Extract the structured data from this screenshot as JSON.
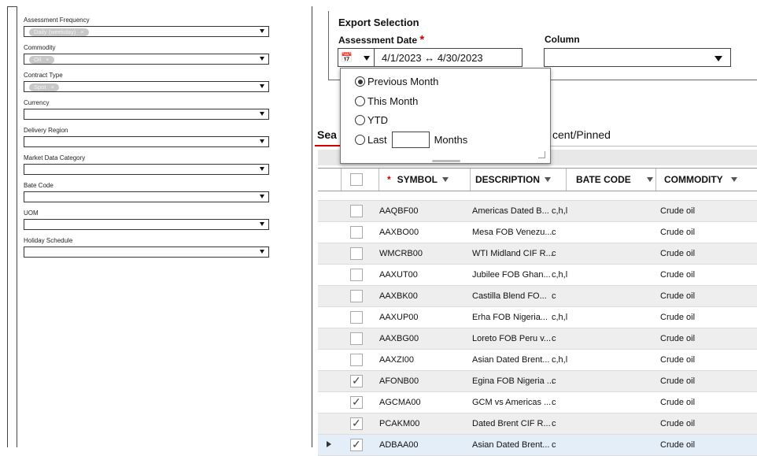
{
  "filters": [
    {
      "label": "Assessment Frequency",
      "chip": "Daily (weekday)"
    },
    {
      "label": "Commodity",
      "chip": "Oil"
    },
    {
      "label": "Contract Type",
      "chip": "Spot"
    },
    {
      "label": "Currency",
      "chip": ""
    },
    {
      "label": "Delivery Region",
      "chip": ""
    },
    {
      "label": "Market Data Category",
      "chip": ""
    },
    {
      "label": "Bate Code",
      "chip": ""
    },
    {
      "label": "UOM",
      "chip": ""
    },
    {
      "label": "Holiday Schedule",
      "chip": ""
    }
  ],
  "export": {
    "title": "Export Selection",
    "assessment_date_label": "Assessment Date",
    "required_mark": "*",
    "date_range": "4/1/2023  ↔  4/30/2023",
    "column_label": "Column"
  },
  "date_popup": {
    "options": [
      "Previous Month",
      "This Month",
      "YTD",
      "Last"
    ],
    "selected": "Previous Month",
    "months_suffix": "Months"
  },
  "tabs": {
    "search": "Sea",
    "recent": "cent/Pinned"
  },
  "grid": {
    "headers": {
      "symbol": "SYMBOL",
      "description": "DESCRIPTION",
      "bate": "BATE CODE",
      "commodity": "COMMODITY"
    },
    "required_mark": "*",
    "rows": [
      {
        "symbol": "AAQBF00",
        "description": "Americas Dated B...",
        "bate": "c,h,l",
        "commodity": "Crude oil",
        "checked": false
      },
      {
        "symbol": "AAXBO00",
        "description": "Mesa FOB Venezu...",
        "bate": "c",
        "commodity": "Crude oil",
        "checked": false
      },
      {
        "symbol": "WMCRB00",
        "description": "WTI Midland CIF R...",
        "bate": "c",
        "commodity": "Crude oil",
        "checked": false
      },
      {
        "symbol": "AAXUT00",
        "description": "Jubilee FOB Ghan...",
        "bate": "c,h,l",
        "commodity": "Crude oil",
        "checked": false
      },
      {
        "symbol": "AAXBK00",
        "description": "Castilla Blend FO...",
        "bate": "c",
        "commodity": "Crude oil",
        "checked": false
      },
      {
        "symbol": "AAXUP00",
        "description": "Erha FOB Nigeria...",
        "bate": "c,h,l",
        "commodity": "Crude oil",
        "checked": false
      },
      {
        "symbol": "AAXBG00",
        "description": "Loreto FOB Peru v...",
        "bate": "c",
        "commodity": "Crude oil",
        "checked": false
      },
      {
        "symbol": "AAXZI00",
        "description": "Asian Dated Brent...",
        "bate": "c,h,l",
        "commodity": "Crude oil",
        "checked": false
      },
      {
        "symbol": "AFONB00",
        "description": "Egina FOB Nigeria ...",
        "bate": "c",
        "commodity": "Crude oil",
        "checked": true
      },
      {
        "symbol": "AGCMA00",
        "description": "GCM vs Americas ...",
        "bate": "c",
        "commodity": "Crude oil",
        "checked": true
      },
      {
        "symbol": "PCAKM00",
        "description": "Dated Brent CIF R...",
        "bate": "c",
        "commodity": "Crude oil",
        "checked": true
      },
      {
        "symbol": "ADBAA00",
        "description": "Asian Dated Brent...",
        "bate": "c",
        "commodity": "Crude oil",
        "checked": true
      }
    ]
  }
}
